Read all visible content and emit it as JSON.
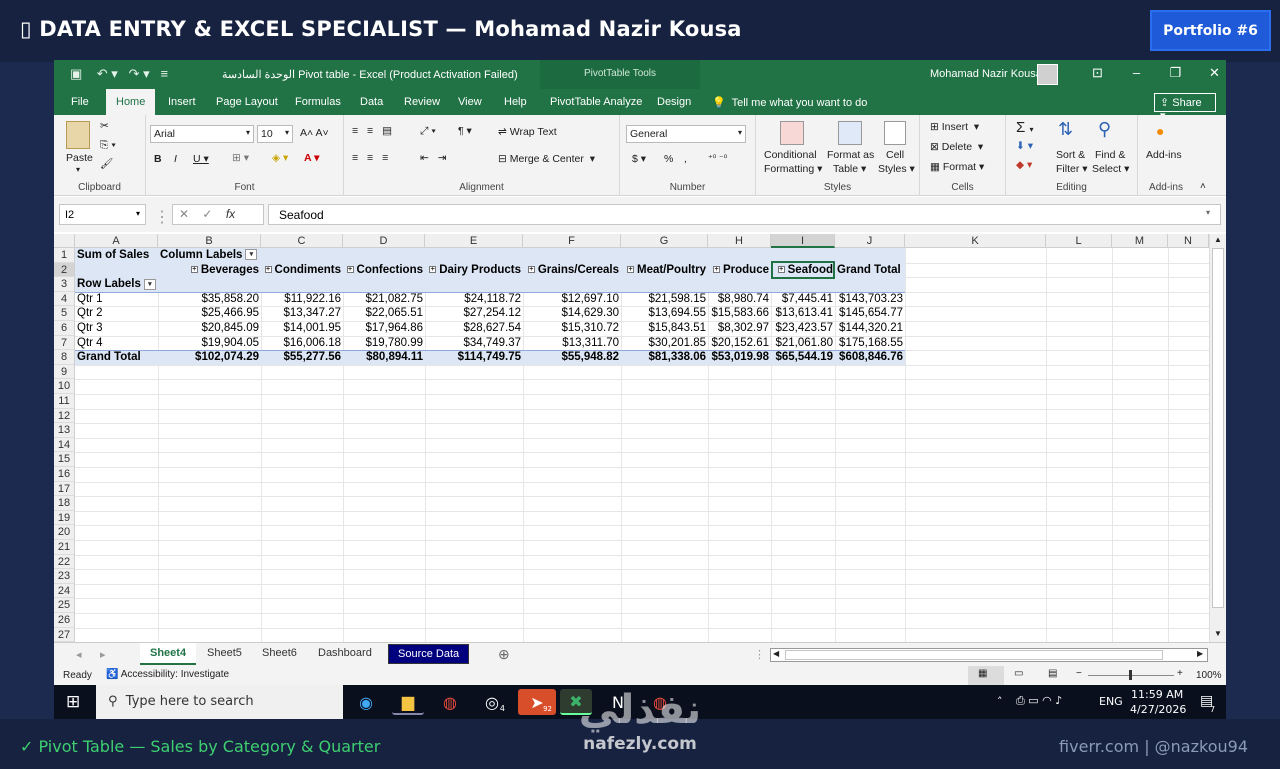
{
  "header": {
    "icon": "chart-emoji",
    "title": "DATA ENTRY & EXCEL SPECIALIST — Mohamad Nazir Kousa",
    "badge": "Portfolio #6"
  },
  "footer": {
    "left": "✓ Pivot Table — Sales by Category & Quarter",
    "right": "fiverr.com | @nazkou94"
  },
  "watermark": {
    "arabic": "نفذلي",
    "latin": "nafezly.com"
  },
  "excel": {
    "window_title": "الوحدة السادسة Pivot table  -  Excel (Product Activation Failed)",
    "context_tab_group": "PivotTable Tools",
    "user": "Mohamad Nazir Kousa",
    "menu_tabs": [
      "File",
      "Home",
      "Insert",
      "Page Layout",
      "Formulas",
      "Data",
      "Review",
      "View",
      "Help",
      "PivotTable Analyze",
      "Design"
    ],
    "active_tab": "Home",
    "tell_me": "Tell me what you want to do",
    "share": "Share",
    "ribbon": {
      "clipboard": {
        "label": "Clipboard",
        "paste": "Paste"
      },
      "font": {
        "label": "Font",
        "family": "Arial",
        "size": "10"
      },
      "alignment": {
        "label": "Alignment",
        "wrap": "Wrap Text",
        "merge": "Merge & Center"
      },
      "number": {
        "label": "Number",
        "format": "General"
      },
      "styles": {
        "label": "Styles",
        "conditional": "Conditional",
        "conditional2": "Formatting",
        "format_as": "Format as",
        "format_as2": "Table",
        "cell": "Cell",
        "cell2": "Styles"
      },
      "cells": {
        "label": "Cells",
        "insert": "Insert",
        "delete": "Delete",
        "format": "Format"
      },
      "editing": {
        "label": "Editing",
        "sort": "Sort &",
        "sort2": "Filter",
        "find": "Find &",
        "find2": "Select"
      },
      "addins": {
        "label": "Add-ins",
        "btn": "Add-ins"
      }
    },
    "name_box": "I2",
    "formula_value": "Seafood",
    "columns": [
      "A",
      "B",
      "C",
      "D",
      "E",
      "F",
      "G",
      "H",
      "I",
      "J",
      "K",
      "L",
      "M",
      "N"
    ],
    "rows": [
      "1",
      "2",
      "3",
      "4",
      "5",
      "6",
      "7",
      "8",
      "9",
      "10",
      "11",
      "12",
      "13",
      "14",
      "15",
      "16",
      "17",
      "18",
      "19",
      "20",
      "21",
      "22",
      "23",
      "24",
      "25",
      "26",
      "27"
    ],
    "pivot": {
      "corner": "Sum of Sales",
      "column_labels": "Column Labels",
      "row_labels": "Row Labels",
      "categories": [
        "Beverages",
        "Condiments",
        "Confections",
        "Dairy Products",
        "Grains/Cereals",
        "Meat/Poultry",
        "Produce",
        "Seafood"
      ],
      "grand_total_label": "Grand Total",
      "rows": [
        {
          "label": "Qtr 1",
          "values": [
            "$35,858.20",
            "$11,922.16",
            "$21,082.75",
            "$24,118.72",
            "$12,697.10",
            "$21,598.15",
            "$8,980.74",
            "$7,445.41",
            "$143,703.23"
          ]
        },
        {
          "label": "Qtr 2",
          "values": [
            "$25,466.95",
            "$13,347.27",
            "$22,065.51",
            "$27,254.12",
            "$14,629.30",
            "$13,694.55",
            "$15,583.66",
            "$13,613.41",
            "$145,654.77"
          ]
        },
        {
          "label": "Qtr 3",
          "values": [
            "$20,845.09",
            "$14,001.95",
            "$17,964.86",
            "$28,627.54",
            "$15,310.72",
            "$15,843.51",
            "$8,302.97",
            "$23,423.57",
            "$144,320.21"
          ]
        },
        {
          "label": "Qtr 4",
          "values": [
            "$19,904.05",
            "$16,006.18",
            "$19,780.99",
            "$34,749.37",
            "$13,311.70",
            "$30,201.85",
            "$20,152.61",
            "$21,061.80",
            "$175,168.55"
          ]
        },
        {
          "label": "Grand Total",
          "values": [
            "$102,074.29",
            "$55,277.56",
            "$80,894.11",
            "$114,749.75",
            "$55,948.82",
            "$81,338.06",
            "$53,019.98",
            "$65,544.19",
            "$608,846.76"
          ]
        }
      ]
    },
    "sheets": [
      "Sheet4",
      "Sheet5",
      "Sheet6",
      "Dashboard",
      "Source Data"
    ],
    "active_sheet": "Sheet4",
    "status": {
      "ready": "Ready",
      "accessibility": "Accessibility: Investigate",
      "zoom": "100%"
    }
  },
  "taskbar": {
    "search_placeholder": "Type here to search",
    "language": "ENG",
    "time": "11:59 AM",
    "date": "4/27/2026",
    "telegram_badge": "92",
    "whatsapp_badge": "4",
    "notif_badge": "7"
  }
}
